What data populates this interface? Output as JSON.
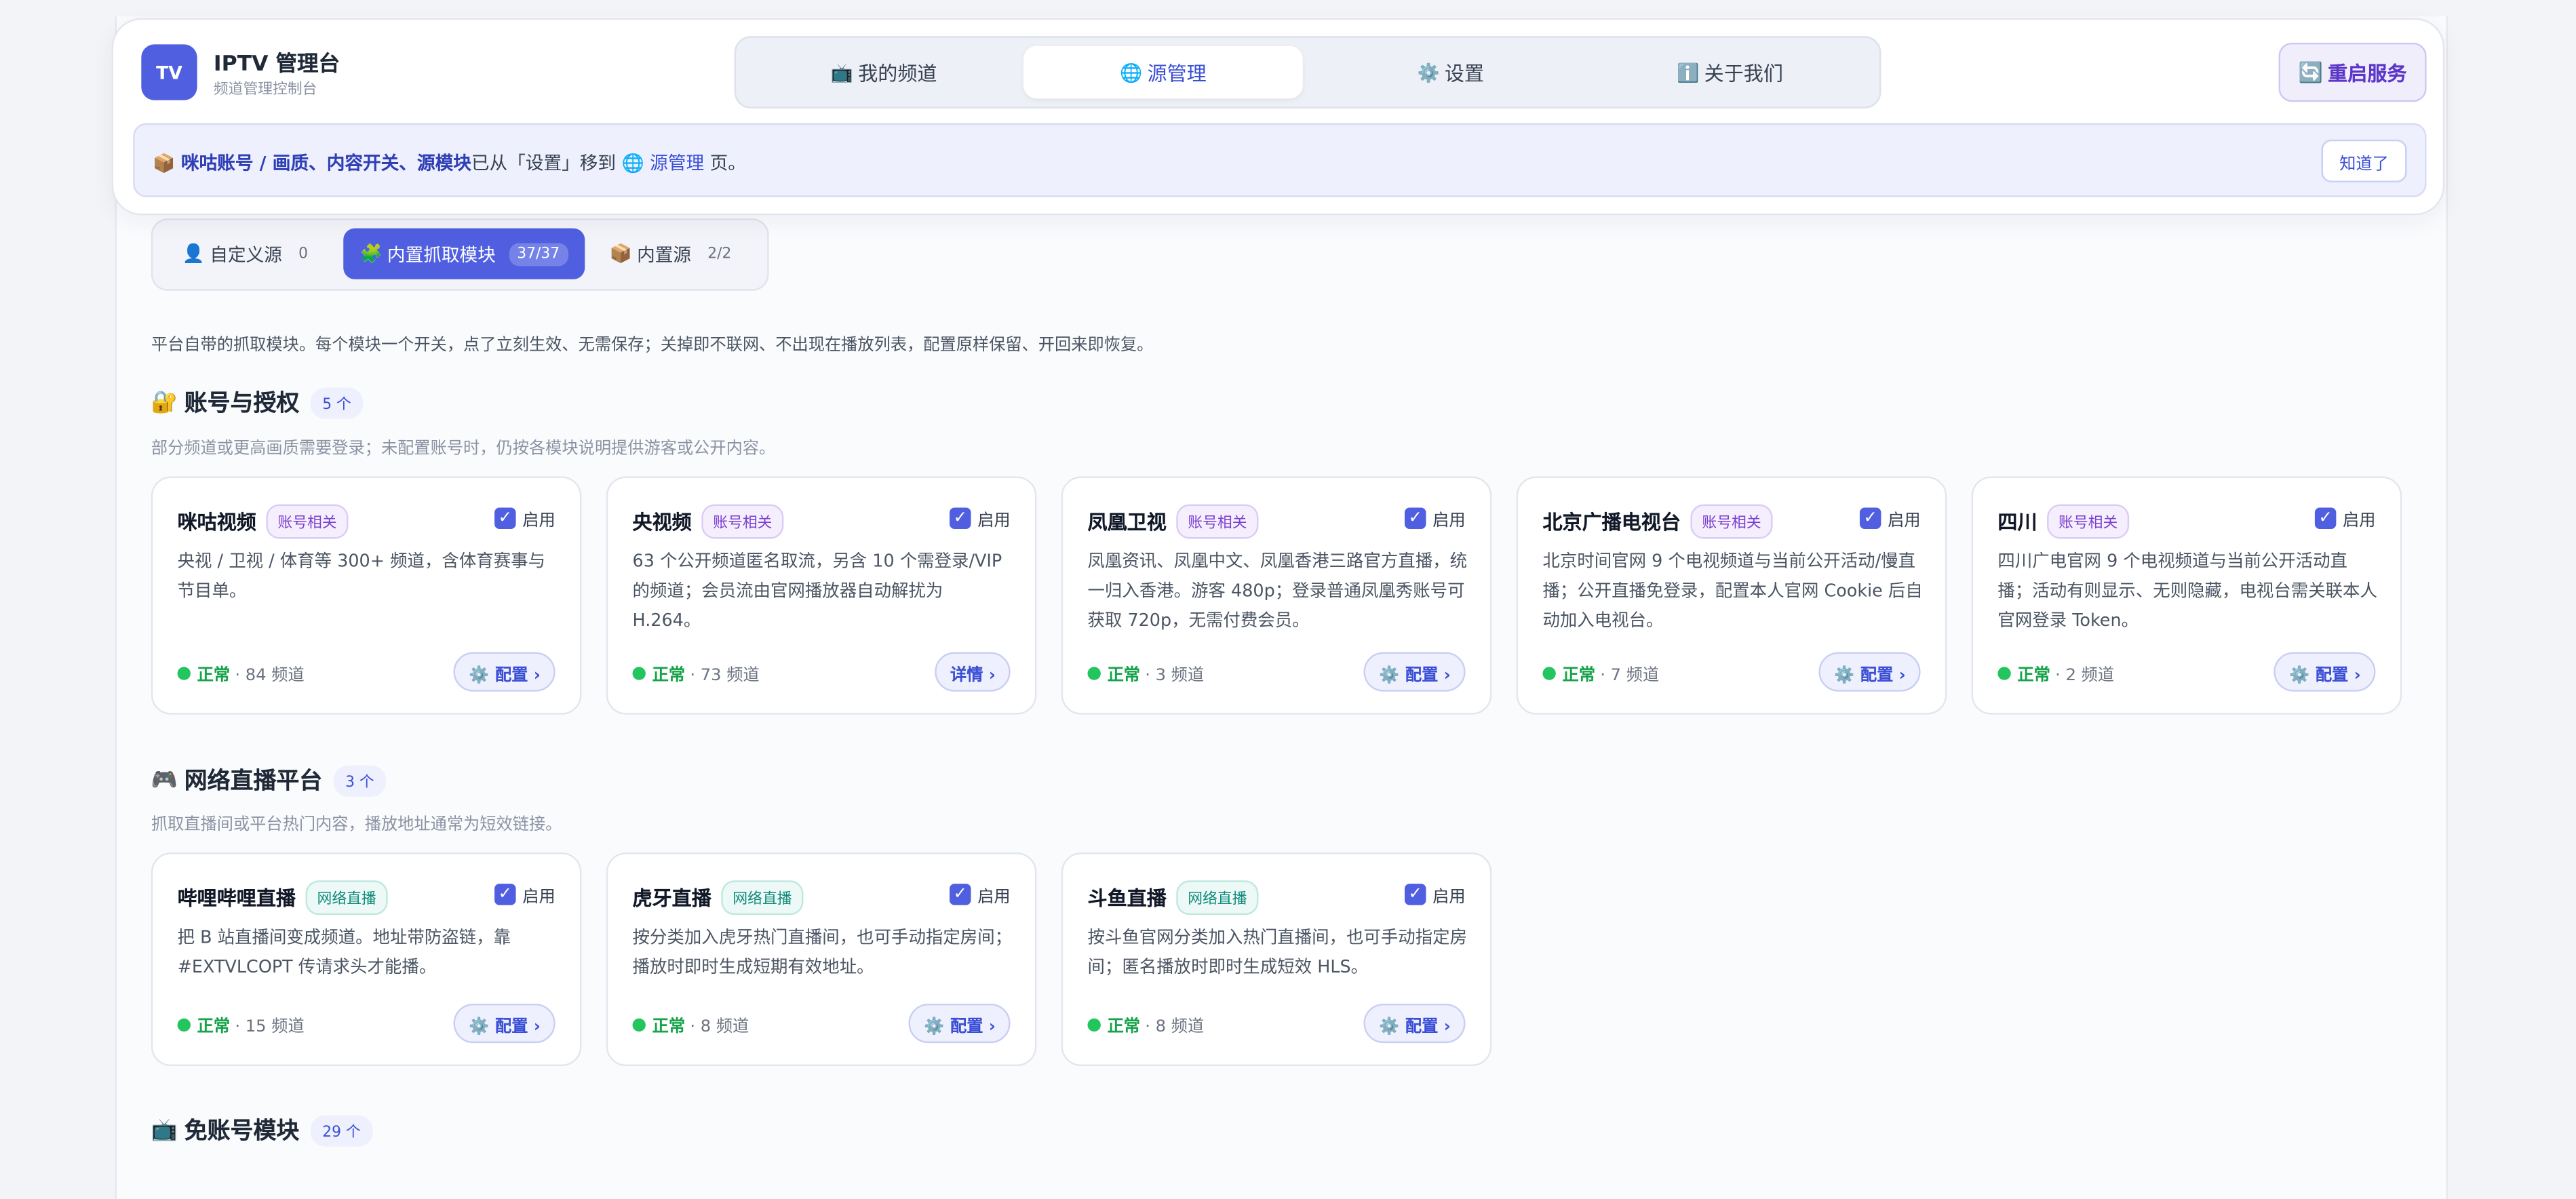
{
  "header": {
    "logo": "TV",
    "title": "IPTV 管理台",
    "subtitle": "频道管理控制台",
    "nav": [
      {
        "icon": "📺",
        "label": "我的频道"
      },
      {
        "icon": "🌐",
        "label": "源管理"
      },
      {
        "icon": "⚙️",
        "label": "设置"
      },
      {
        "icon": "ℹ️",
        "label": "关于我们"
      }
    ],
    "restart": {
      "icon": "🔄",
      "label": "重启服务"
    }
  },
  "notice": {
    "icon": "📦",
    "bold": "咪咕账号 / 画质、内容开关、源模块",
    "mid": "已从「设置」移到",
    "link": "🌐 源管理",
    "tail": " 页。",
    "button": "知道了"
  },
  "subtabs": [
    {
      "icon": "👤",
      "label": "自定义源",
      "count": "0"
    },
    {
      "icon": "🧩",
      "label": "内置抓取模块",
      "count": "37/37"
    },
    {
      "icon": "📦",
      "label": "内置源",
      "count": "2/2"
    }
  ],
  "intro": "平台自带的抓取模块。每个模块一个开关，点了立刻生效、无需保存；关掉即不联网、不出现在播放列表，配置原样保留、开回来即恢复。",
  "toggle_label": "启用",
  "status_ok": "正常",
  "sections": [
    {
      "icon": "🔐",
      "title": "账号与授权",
      "count": "5 个",
      "desc": "部分频道或更高画质需要登录；未配置账号时，仍按各模块说明提供游客或公开内容。",
      "cards": [
        {
          "name": "咪咕视频",
          "tag": "账号相关",
          "desc": "央视 / 卫视 / 体育等 300+ 频道，含体育赛事与节目单。",
          "channels": "· 84 频道",
          "button": "⚙️ 配置 ›"
        },
        {
          "name": "央视频",
          "tag": "账号相关",
          "desc": "63 个公开频道匿名取流，另含 10 个需登录/VIP 的频道；会员流由官网播放器自动解扰为 H.264。",
          "channels": "· 73 频道",
          "button": "详情 ›"
        },
        {
          "name": "凤凰卫视",
          "tag": "账号相关",
          "desc": "凤凰资讯、凤凰中文、凤凰香港三路官方直播，统一归入香港。游客 480p；登录普通凤凰秀账号可获取 720p，无需付费会员。",
          "channels": "· 3 频道",
          "button": "⚙️ 配置 ›"
        },
        {
          "name": "北京广播电视台",
          "tag": "账号相关",
          "desc": "北京时间官网 9 个电视频道与当前公开活动/慢直播；公开直播免登录，配置本人官网 Cookie 后自动加入电视台。",
          "channels": "· 7 频道",
          "button": "⚙️ 配置 ›"
        },
        {
          "name": "四川",
          "tag": "账号相关",
          "desc": "四川广电官网 9 个电视频道与当前公开活动直播；活动有则显示、无则隐藏，电视台需关联本人官网登录 Token。",
          "channels": "· 2 频道",
          "button": "⚙️ 配置 ›"
        }
      ]
    },
    {
      "icon": "🎮",
      "title": "网络直播平台",
      "count": "3 个",
      "desc": "抓取直播间或平台热门内容，播放地址通常为短效链接。",
      "cards": [
        {
          "name": "哔哩哔哩直播",
          "tag": "网络直播",
          "desc": "把 B 站直播间变成频道。地址带防盗链，靠 #EXTVLCOPT 传请求头才能播。",
          "channels": "· 15 频道",
          "button": "⚙️ 配置 ›"
        },
        {
          "name": "虎牙直播",
          "tag": "网络直播",
          "desc": "按分类加入虎牙热门直播间，也可手动指定房间；播放时即时生成短期有效地址。",
          "channels": "· 8 频道",
          "button": "⚙️ 配置 ›"
        },
        {
          "name": "斗鱼直播",
          "tag": "网络直播",
          "desc": "按斗鱼官网分类加入热门直播间，也可手动指定房间；匿名播放时即时生成短效 HLS。",
          "channels": "· 8 频道",
          "button": "⚙️ 配置 ›"
        }
      ]
    },
    {
      "icon": "📺",
      "title": "免账号模块",
      "count": "29 个"
    }
  ]
}
